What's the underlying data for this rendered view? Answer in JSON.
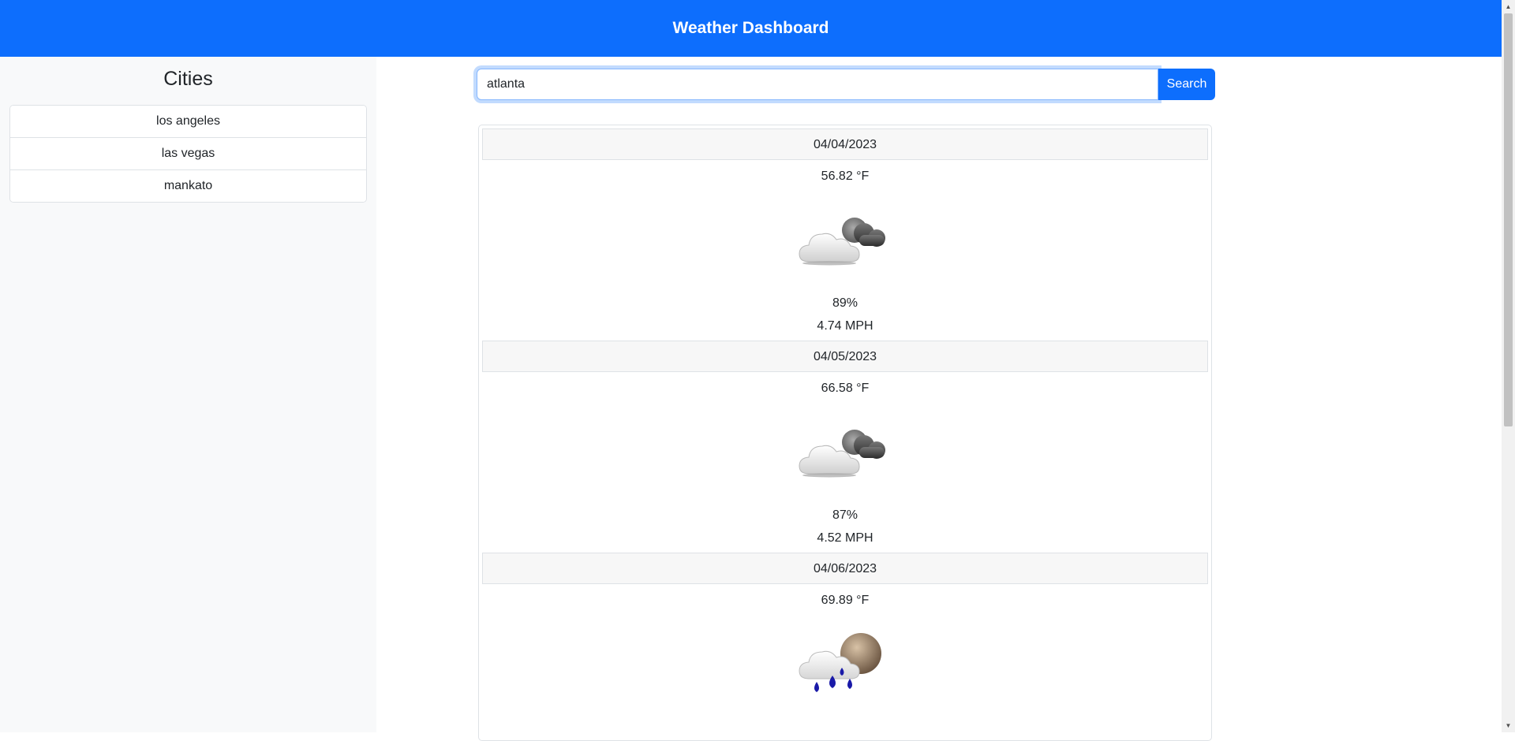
{
  "header": {
    "title": "Weather Dashboard"
  },
  "sidebar": {
    "title": "Cities",
    "cities": [
      "los angeles",
      "las vegas",
      "mankato"
    ]
  },
  "search": {
    "value": "atlanta",
    "button_label": "Search"
  },
  "forecast": [
    {
      "date": "04/04/2023",
      "temp": "56.82 °F",
      "icon": "partly-cloudy-icon",
      "humidity": "89%",
      "wind": "4.74 MPH"
    },
    {
      "date": "04/05/2023",
      "temp": "66.58 °F",
      "icon": "partly-cloudy-icon",
      "humidity": "87%",
      "wind": "4.52 MPH"
    },
    {
      "date": "04/06/2023",
      "temp": "69.89 °F",
      "icon": "rain-icon",
      "humidity": "",
      "wind": ""
    }
  ],
  "colors": {
    "primary": "#0d6efd",
    "sidebar_bg": "#f8f9fa",
    "date_bg": "#f7f7f7"
  }
}
